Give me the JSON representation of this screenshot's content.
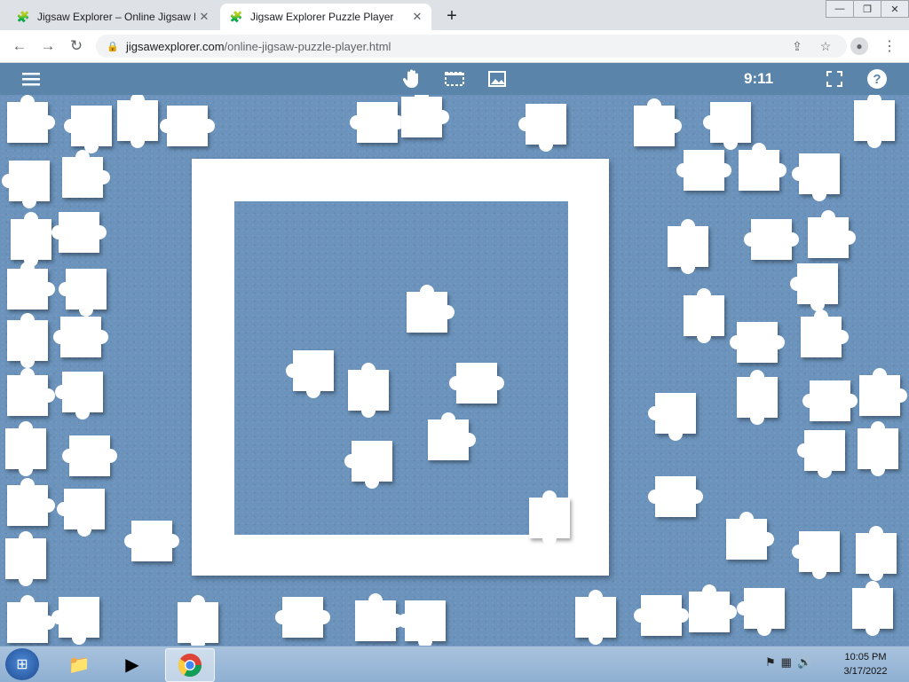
{
  "browser": {
    "tabs": [
      {
        "title": "Jigsaw Explorer – Online Jigsaw P",
        "favicon": "jigsaw-favicon",
        "active": false
      },
      {
        "title": "Jigsaw Explorer Puzzle Player",
        "favicon": "jigsaw-favicon",
        "active": true
      }
    ],
    "url_host": "jigsawexplorer.com",
    "url_path": "/online-jigsaw-puzzle-player.html"
  },
  "app": {
    "timer": "9:11",
    "icons": [
      "menu-icon",
      "hand-icon",
      "selection-icon",
      "image-icon",
      "fullscreen-icon",
      "help-icon"
    ]
  },
  "taskbar": {
    "time": "10:05 PM",
    "date": "3/17/2022",
    "pinned": [
      "start-button",
      "file-explorer-icon",
      "media-player-icon",
      "chrome-icon"
    ]
  },
  "colors": {
    "appbar": "#5b84ab",
    "board": "#6b93bc",
    "piece": "#ffffff"
  }
}
